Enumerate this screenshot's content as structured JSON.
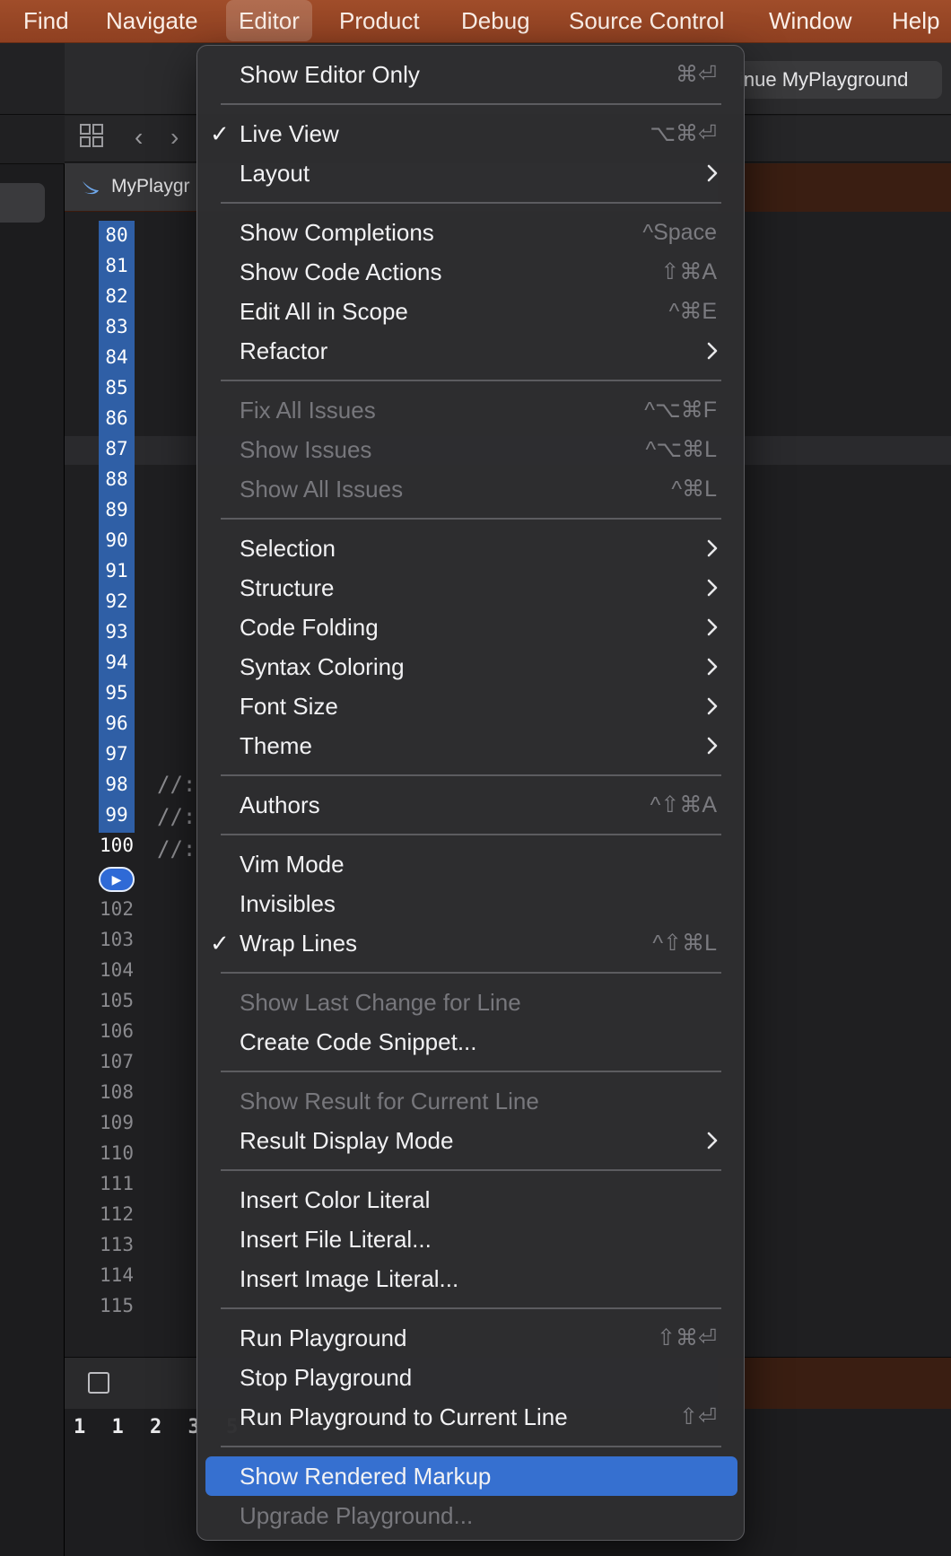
{
  "menubar": {
    "items": [
      "Find",
      "Navigate",
      "Editor",
      "Product",
      "Debug",
      "Source Control",
      "Window",
      "Help"
    ],
    "active": "Editor"
  },
  "toolbar": {
    "run_status": "inue MyPlayground"
  },
  "jump_bar": {
    "file": "MyPlaygr"
  },
  "editor": {
    "lines": [
      "80",
      "81",
      "82",
      "83",
      "84",
      "85",
      "86",
      "87",
      "88",
      "89",
      "90",
      "91",
      "92",
      "93",
      "94",
      "95",
      "96",
      "97",
      "98",
      "99",
      "100",
      "102",
      "103",
      "104",
      "105",
      "106",
      "107",
      "108",
      "109",
      "110",
      "111",
      "112",
      "113",
      "114",
      "115"
    ],
    "comments": [
      "//:",
      "//:",
      "//:"
    ]
  },
  "console": {
    "text": "1 1 2 3 5"
  },
  "menu": {
    "items": [
      {
        "label": "Show Editor Only",
        "shortcut": "⌘⏎"
      },
      {
        "label": "Live View",
        "shortcut": "⌥⌘⏎",
        "checked": true
      },
      {
        "label": "Layout",
        "submenu": true
      },
      {
        "label": "Show Completions",
        "shortcut": "^Space"
      },
      {
        "label": "Show Code Actions",
        "shortcut": "⇧⌘A"
      },
      {
        "label": "Edit All in Scope",
        "shortcut": "^⌘E"
      },
      {
        "label": "Refactor",
        "submenu": true
      },
      {
        "label": "Fix All Issues",
        "shortcut": "^⌥⌘F",
        "disabled": true
      },
      {
        "label": "Show Issues",
        "shortcut": "^⌥⌘L",
        "disabled": true
      },
      {
        "label": "Show All Issues",
        "shortcut": "^⌘L",
        "disabled": true
      },
      {
        "label": "Selection",
        "submenu": true
      },
      {
        "label": "Structure",
        "submenu": true
      },
      {
        "label": "Code Folding",
        "submenu": true
      },
      {
        "label": "Syntax Coloring",
        "submenu": true
      },
      {
        "label": "Font Size",
        "submenu": true
      },
      {
        "label": "Theme",
        "submenu": true
      },
      {
        "label": "Authors",
        "shortcut": "^⇧⌘A"
      },
      {
        "label": "Vim Mode"
      },
      {
        "label": "Invisibles"
      },
      {
        "label": "Wrap Lines",
        "shortcut": "^⇧⌘L",
        "checked": true
      },
      {
        "label": "Show Last Change for Line",
        "disabled": true
      },
      {
        "label": "Create Code Snippet..."
      },
      {
        "label": "Show Result for Current Line",
        "disabled": true
      },
      {
        "label": "Result Display Mode",
        "submenu": true
      },
      {
        "label": "Insert Color Literal"
      },
      {
        "label": "Insert File Literal..."
      },
      {
        "label": "Insert Image Literal..."
      },
      {
        "label": "Run Playground",
        "shortcut": "⇧⌘⏎"
      },
      {
        "label": "Stop Playground"
      },
      {
        "label": "Run Playground to Current Line",
        "shortcut": "⇧⏎"
      },
      {
        "label": "Show Rendered Markup",
        "highlighted": true
      },
      {
        "label": "Upgrade Playground...",
        "disabled": true
      }
    ]
  },
  "colors": {
    "menubar": "#9a4726",
    "menu_bg": "#2e2e30",
    "highlight": "#3670d0",
    "gutter_run": "#2f5fa6"
  }
}
